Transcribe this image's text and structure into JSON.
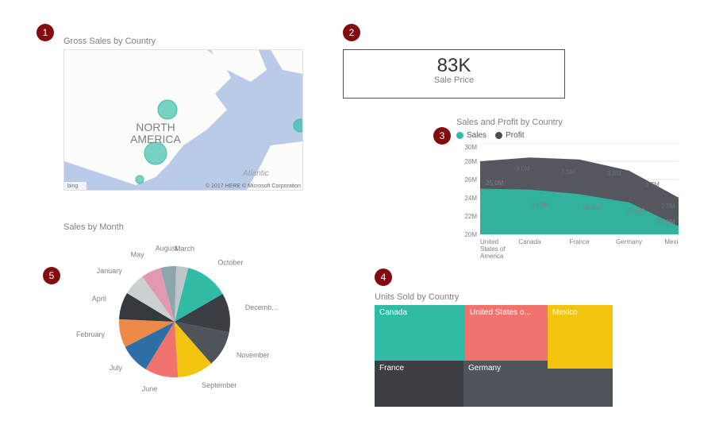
{
  "badges": {
    "b1": "1",
    "b2": "2",
    "b3": "3",
    "b4": "4",
    "b5": "5"
  },
  "map": {
    "title": "Gross Sales by Country",
    "continent_label": "NORTH AMERICA",
    "ocean_label": "Atlantic",
    "attr_prefix": "bing",
    "attr": "© 2017 HERE © Microsoft Corporation"
  },
  "card": {
    "value": "83K",
    "caption": "Sale Price"
  },
  "area": {
    "title": "Sales and Profit by Country",
    "legend": {
      "sales": "Sales",
      "profit": "Profit"
    },
    "yticks": [
      "20M",
      "22M",
      "24M",
      "26M",
      "28M",
      "30M"
    ],
    "xcats": [
      "United States of America",
      "Canada",
      "France",
      "Germany",
      "Mexico"
    ],
    "sales_labels": [
      "25.0M",
      "24.9M",
      "24.4M",
      "23.5M",
      "20.9M"
    ],
    "profit_labels": [
      "3.0M",
      "3.5M",
      "3.8M",
      "3.7M",
      "2.9M"
    ]
  },
  "pie": {
    "title": "Sales by Month",
    "labels": [
      "October",
      "Decemb...",
      "November",
      "September",
      "June",
      "July",
      "February",
      "April",
      "January",
      "May",
      "August",
      "March"
    ]
  },
  "treemap": {
    "title": "Units Sold by Country",
    "cells": {
      "canada": "Canada",
      "usa": "United States o...",
      "mexico": "Mexico",
      "france": "France",
      "germany": "Germany"
    }
  },
  "colors": {
    "teal": "#2fbba6",
    "dark": "#3b3f44",
    "slate": "#4e545a",
    "red": "#f0736e",
    "gold": "#f2c40f",
    "blue": "#2d6ea4",
    "orange": "#ed8a4a",
    "pink": "#e099b0",
    "lt": "#cbd0d3",
    "dk2": "#35393d"
  },
  "chart_data": [
    {
      "type": "map",
      "title": "Gross Sales by Country",
      "series": [
        {
          "name": "Gross Sales",
          "points": [
            {
              "country": "United States of America",
              "value": null
            },
            {
              "country": "Canada",
              "value": null
            },
            {
              "country": "Mexico",
              "value": null
            },
            {
              "country": "France",
              "value": null
            }
          ]
        }
      ],
      "notes": "Bubble map on Bing base layer; bubble size encodes gross sales (values not labeled)."
    },
    {
      "type": "card",
      "title": "Sale Price",
      "value": 83000,
      "display": "83K"
    },
    {
      "type": "area",
      "title": "Sales and Profit by Country",
      "categories": [
        "United States of America",
        "Canada",
        "France",
        "Germany",
        "Mexico"
      ],
      "series": [
        {
          "name": "Sales",
          "values": [
            25.0,
            24.9,
            24.4,
            23.5,
            20.9
          ],
          "unit": "M"
        },
        {
          "name": "Profit",
          "values": [
            3.0,
            3.5,
            3.8,
            3.7,
            2.9
          ],
          "unit": "M"
        }
      ],
      "stacked": true,
      "ylabel": "",
      "ylim": [
        20,
        30
      ],
      "yticks": [
        20,
        22,
        24,
        26,
        28,
        30
      ],
      "legend_position": "top-left"
    },
    {
      "type": "pie",
      "title": "Sales by Month",
      "categories": [
        "October",
        "December",
        "November",
        "September",
        "June",
        "July",
        "February",
        "April",
        "January",
        "May",
        "August",
        "March"
      ],
      "values": [
        12.7,
        11.4,
        10.5,
        10.5,
        9.7,
        8.8,
        8.2,
        7.9,
        6.5,
        5.8,
        4.6,
        3.5
      ],
      "unit": "%",
      "notes": "Slice values estimated from relative arc size; no data labels shown."
    },
    {
      "type": "treemap",
      "title": "Units Sold by Country",
      "categories": [
        "Canada",
        "United States of America",
        "Mexico",
        "France",
        "Germany"
      ],
      "values": [
        247000,
        233000,
        203000,
        241000,
        201000
      ],
      "notes": "Values estimated from rectangle areas; no numeric labels shown."
    }
  ]
}
